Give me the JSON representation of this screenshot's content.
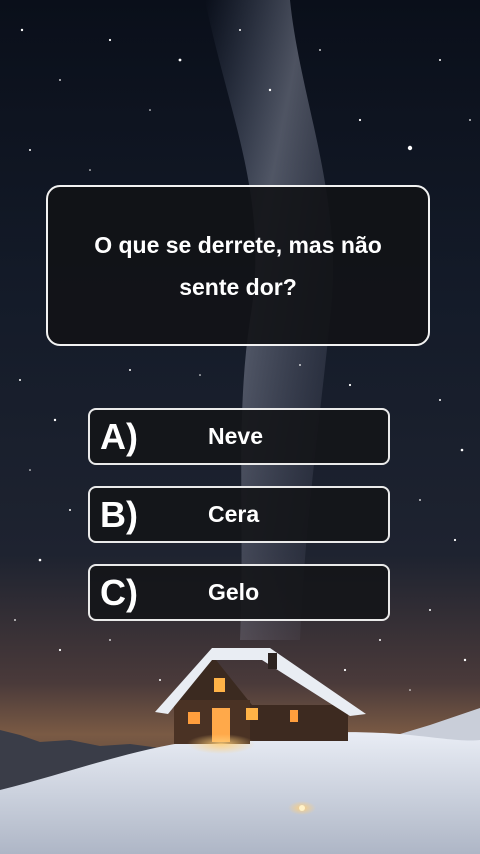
{
  "question": {
    "text": "O que se derrete, mas não sente dor?"
  },
  "answers": [
    {
      "letter": "A)",
      "label": "Neve"
    },
    {
      "letter": "B)",
      "label": "Cera"
    },
    {
      "letter": "C)",
      "label": "Gelo"
    }
  ],
  "colors": {
    "panel_background": "#141518",
    "panel_border": "#f2f2f2",
    "text": "#ffffff",
    "sky_top": "#0a0f1a",
    "snow": "#e6eaf2",
    "window_glow": "#ffb347"
  }
}
